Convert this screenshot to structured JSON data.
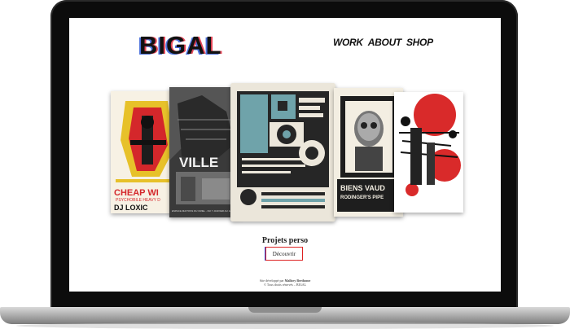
{
  "brand": {
    "logo_text": "BIGAL"
  },
  "nav": {
    "items": [
      {
        "label": "WORK"
      },
      {
        "label": "ABOUT"
      },
      {
        "label": "SHOP"
      }
    ]
  },
  "gallery": {
    "cards": [
      {
        "title_line1": "CHEAP WI",
        "title_line2": "PSYCHOBILE HEAVY D",
        "title_line3": "DJ LOXIC"
      },
      {
        "title_line1": "VILLE",
        "caption": "ESPACE MAITOSS DU CRIEL - DU 7 JANVIER AU 12"
      },
      {
        "title_line1": ""
      },
      {
        "title_line1": "BIENS VAUD",
        "title_line2": "RODINGER'S PIPE"
      },
      {
        "title_line1": ""
      }
    ]
  },
  "section": {
    "title": "Projets perso",
    "button_label": "Découvrir"
  },
  "footer": {
    "line1_prefix": "Site développé par",
    "line1_name": "Mallory Berthome",
    "line2": "© Tous droits réservés – BIGAL"
  },
  "colors": {
    "accent_red": "#e0263b",
    "accent_blue": "#2d59d6",
    "teal": "#6fa3aa"
  }
}
